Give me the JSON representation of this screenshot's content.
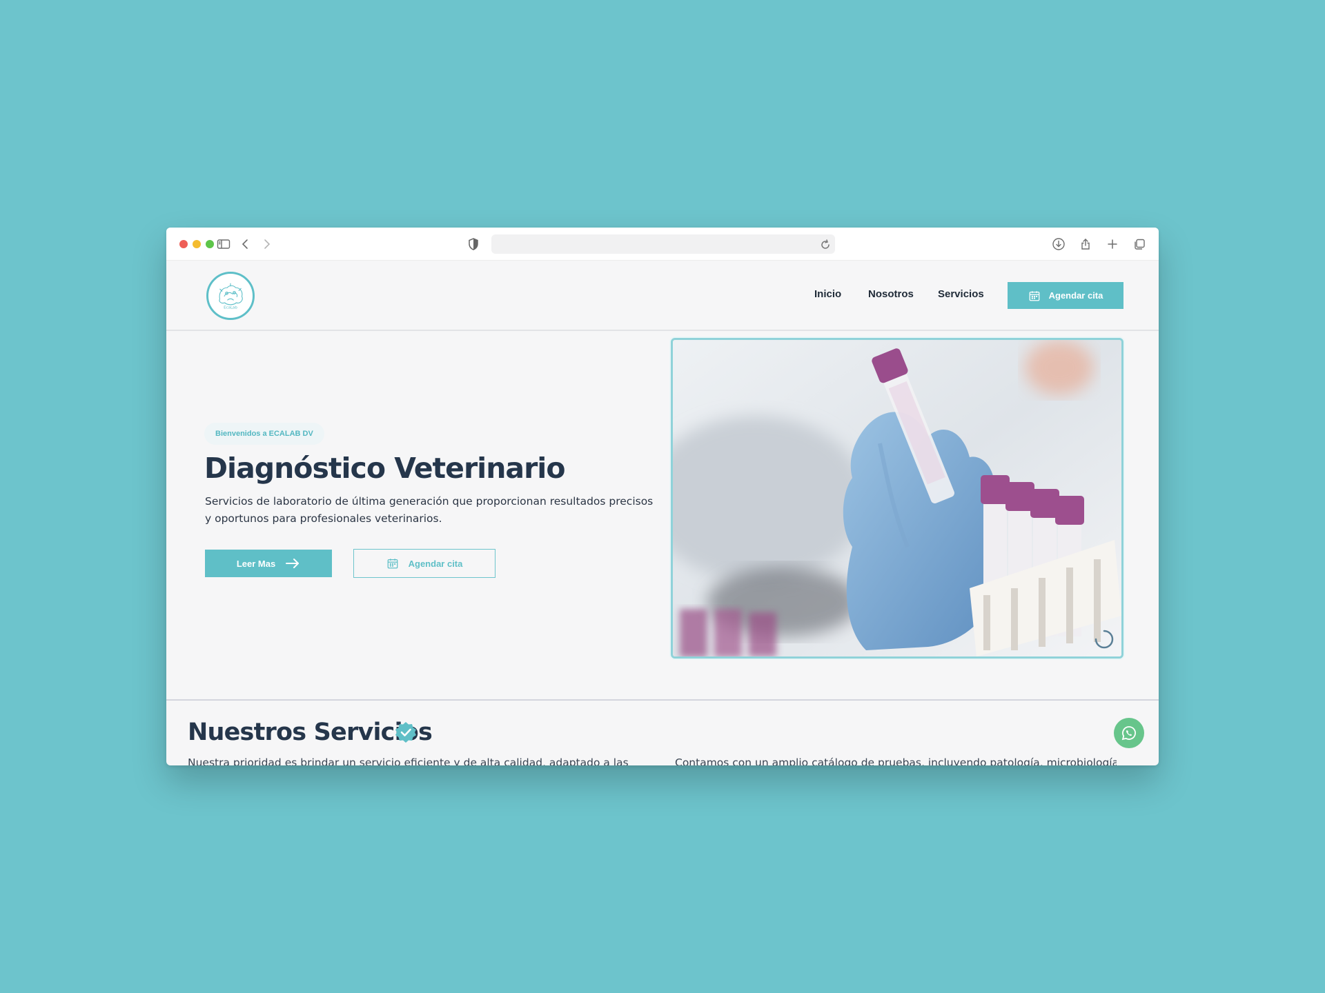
{
  "browser": {
    "address_value": ""
  },
  "header": {
    "logo_alt": "ECALAB DV",
    "nav": [
      "Inicio",
      "Nosotros",
      "Servicios"
    ],
    "cta_label": "Agendar cita"
  },
  "hero": {
    "badge": "Bienvenidos a ECALAB DV",
    "title": "Diagnóstico Veterinario",
    "description": "Servicios de laboratorio de última generación que proporcionan resultados precisos y oportunos para profesionales veterinarios.",
    "primary_button": "Leer Mas",
    "secondary_button": "Agendar cita"
  },
  "services": {
    "title": "Nuestros Servicios",
    "left_text": "Nuestra prioridad es brindar un servicio eficiente y de alta calidad, adaptado a las",
    "right_text": "Contamos con un amplio catálogo de pruebas, incluyendo patología, microbiología"
  },
  "colors": {
    "accent": "#5fbfc7",
    "heading": "#25364b",
    "whatsapp": "#67c58b"
  },
  "icons": {
    "calendar": "calendar-icon",
    "arrow": "arrow-right-icon",
    "verified": "verified-badge-icon",
    "whatsapp": "whatsapp-icon"
  }
}
